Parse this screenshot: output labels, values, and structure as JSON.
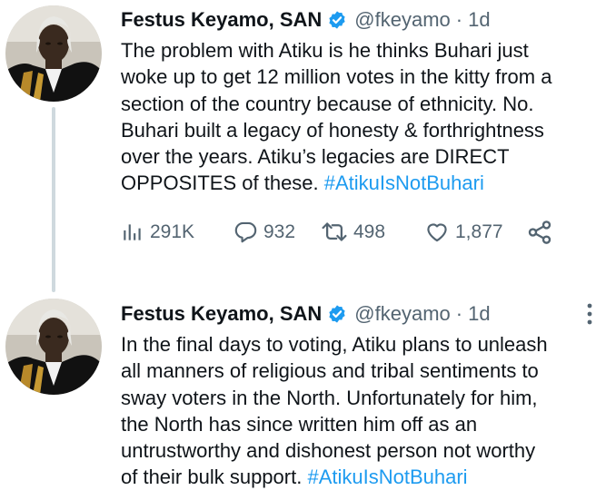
{
  "tweets": [
    {
      "display_name": "Festus Keyamo, SAN",
      "handle": "@fkeyamo",
      "separator": "·",
      "time": "1d",
      "text_lines": [
        "The problem with Atiku is he thinks Buhari just",
        "woke up to get 12 million votes in the kitty from a",
        "section of the country because of ethnicity. No.",
        "Buhari built a legacy of honesty & forthrightness",
        "over the years. Atiku’s legacies are DIRECT",
        "OPPOSITES of these. "
      ],
      "hashtag": "#AtikuIsNotBuhari",
      "stats": {
        "views": "291K",
        "replies": "932",
        "retweets": "498",
        "likes": "1,877"
      },
      "icons": [
        "views-icon",
        "reply-icon",
        "retweet-icon",
        "like-icon",
        "share-icon"
      ]
    },
    {
      "display_name": "Festus Keyamo, SAN",
      "handle": "@fkeyamo",
      "separator": "·",
      "time": "1d",
      "text_lines": [
        "In the final days to voting, Atiku plans to unleash",
        "all manners of religious and tribal sentiments to",
        "sway voters in the North. Unfortunately for him,",
        "the North has since written him off as an",
        "untrustworthy and dishonest person not worthy",
        "of their bulk support. "
      ],
      "hashtag": "#AtikuIsNotBuhari"
    }
  ],
  "colors": {
    "text": "#0f1419",
    "secondary": "#536471",
    "accent": "#1d9bf0",
    "thread_line": "#cfd9de"
  }
}
